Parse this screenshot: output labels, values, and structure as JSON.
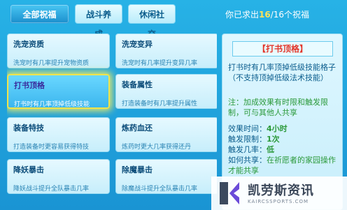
{
  "tabs": [
    {
      "label": "全部祝福",
      "active": true
    },
    {
      "label": "战斗养成",
      "active": false
    },
    {
      "label": "休闲社交",
      "active": false
    }
  ],
  "progress": {
    "prefix": "你已求出",
    "current": "16",
    "separator": "/",
    "total": "16",
    "suffix": "个祝福"
  },
  "blessings": [
    {
      "title": "洗宠资质",
      "desc": "洗宠时有几率提升宠物资质"
    },
    {
      "title": "洗宠变异",
      "desc": "洗宠时有几率提升变异几率"
    },
    {
      "title": "打书顶格",
      "desc": "打书时有几率顶掉低级技能"
    },
    {
      "title": "装备属性",
      "desc": "打造装备时有几率提升属性"
    },
    {
      "title": "装备特技",
      "desc": "打造装备时更容易获得特技"
    },
    {
      "title": "炼药血还",
      "desc": "炼药时更大几率获得还丹"
    },
    {
      "title": "降妖暴击",
      "desc": "降妖战斗提升全队暴击几率"
    },
    {
      "title": "除魔暴击",
      "desc": "除魔战斗提升全队暴击几率"
    }
  ],
  "detail": {
    "title": "【打书顶格】",
    "description": "打书时有几率顶掉低级技能格子（不支持顶掉低级法术技能）",
    "note": "注：加成效果有时限和触发限制，可与其他人共享",
    "stats": [
      {
        "label": "效果时间：",
        "value": "4小时"
      },
      {
        "label": "触发限制：",
        "value": "1次"
      },
      {
        "label": "触发几率：",
        "value": "低"
      }
    ],
    "share": {
      "label": "如何共享：",
      "value": "在祈愿者的家园操作才能共享"
    }
  },
  "watermark": {
    "name": "凯劳斯资讯",
    "url": "KAIRCSSPORTS.COM"
  },
  "colors": {
    "accent": "#1f9fd8",
    "highlight": "#e2372b",
    "green": "#2c9a3b",
    "gold": "#ffe25a"
  }
}
